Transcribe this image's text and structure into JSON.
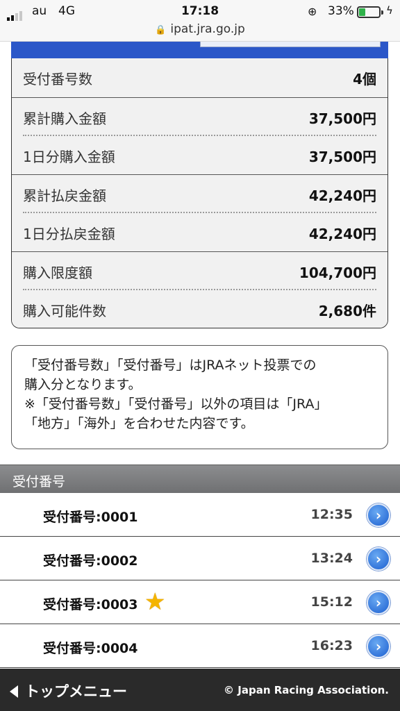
{
  "status_bar": {
    "carrier": "au",
    "network": "4G",
    "time": "17:18",
    "battery_percent": "33%",
    "battery_level": 0.33,
    "url": "ipat.jra.go.jp"
  },
  "summary": {
    "rows": [
      {
        "label": "受付番号数",
        "value": "4個"
      },
      {
        "label": "累計購入金額",
        "value": "37,500円"
      },
      {
        "label": "1日分購入金額",
        "value": "37,500円"
      },
      {
        "label": "累計払戻金額",
        "value": "42,240円"
      },
      {
        "label": "1日分払戻金額",
        "value": "42,240円"
      },
      {
        "label": "購入限度額",
        "value": "104,700円"
      },
      {
        "label": "購入可能件数",
        "value": "2,680件"
      }
    ]
  },
  "note": {
    "line1": "「受付番号数」「受付番号」はJRAネット投票での",
    "line2": "購入分となります。",
    "line3": "※「受付番号数」「受付番号」以外の項目は「JRA」",
    "line4": "「地方」「海外」を合わせた内容です。"
  },
  "receipts": {
    "header": "受付番号",
    "items": [
      {
        "label": "受付番号:0001",
        "time": "12:35",
        "starred": false
      },
      {
        "label": "受付番号:0002",
        "time": "13:24",
        "starred": false
      },
      {
        "label": "受付番号:0003",
        "time": "15:12",
        "starred": true
      },
      {
        "label": "受付番号:0004",
        "time": "16:23",
        "starred": false
      }
    ]
  },
  "footer": {
    "back_label": "トップメニュー",
    "copyright": "© Japan Racing Association."
  },
  "colors": {
    "accent_blue": "#2b57c8",
    "star": "#f4b400",
    "footer_bg": "#2a2a2a"
  }
}
